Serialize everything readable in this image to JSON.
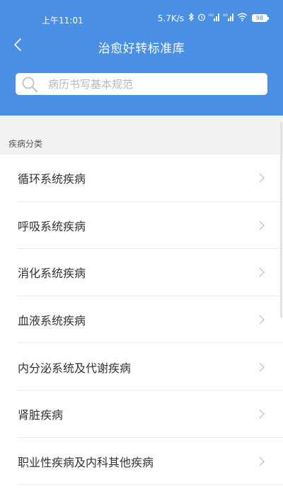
{
  "status": {
    "time": "上午11:01",
    "speed": "5.7K/s",
    "battery": "98",
    "network_label": "HD"
  },
  "header": {
    "title": "治愈好转标准库"
  },
  "search": {
    "placeholder": "病历书写基本规范"
  },
  "section": {
    "label": "疾病分类"
  },
  "list": {
    "items": [
      {
        "label": "循环系统疾病"
      },
      {
        "label": "呼吸系统疾病"
      },
      {
        "label": "消化系统疾病"
      },
      {
        "label": "血液系统疾病"
      },
      {
        "label": "内分泌系统及代谢疾病"
      },
      {
        "label": "肾脏疾病"
      },
      {
        "label": "职业性疾病及内科其他疾病"
      }
    ]
  },
  "colors": {
    "header_bg": "#4a8fe6",
    "section_bg": "#f2f2f2",
    "text": "#333333",
    "divider": "#ececec"
  }
}
